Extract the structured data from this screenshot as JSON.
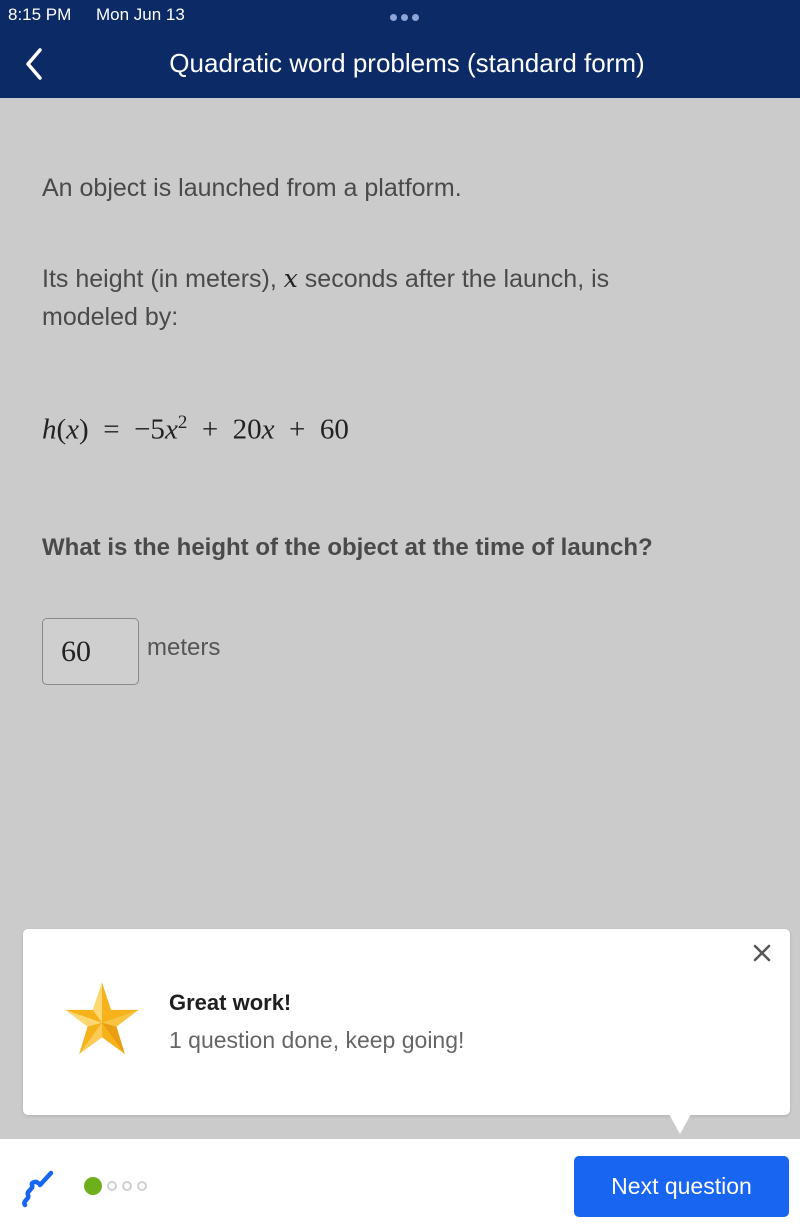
{
  "status_bar": {
    "time": "8:15 PM",
    "date": "Mon Jun 13"
  },
  "header": {
    "title": "Quadratic word problems (standard form)",
    "back_icon": "chevron-left-icon"
  },
  "problem": {
    "intro": "An object is launched from a platform.",
    "model_before": "Its height (in meters), ",
    "model_var": "x",
    "model_after": " seconds after the launch, is modeled by:",
    "equation": {
      "lhs_fn": "h",
      "lhs_var": "x",
      "equals": "=",
      "term1_coef": "−5",
      "term1_var": "x",
      "term1_exp": "2",
      "op1": "+",
      "term2_coef": "20",
      "term2_var": "x",
      "op2": "+",
      "const": "60"
    },
    "question": "What is the height of the object at the time of launch?",
    "answer_value": "60",
    "answer_unit": "meters"
  },
  "toast": {
    "icon": "star-icon",
    "title": "Great work!",
    "message": "1 question done, keep going!",
    "close_icon": "close-icon"
  },
  "footer": {
    "scratchpad_icon": "scratchpad-icon",
    "progress": {
      "completed": 1,
      "total": 4
    },
    "next_label": "Next question"
  },
  "colors": {
    "header_bg": "#0c2b66",
    "primary_button": "#1865f2",
    "progress_done": "#6eb01b",
    "star": "#f5b21b"
  }
}
